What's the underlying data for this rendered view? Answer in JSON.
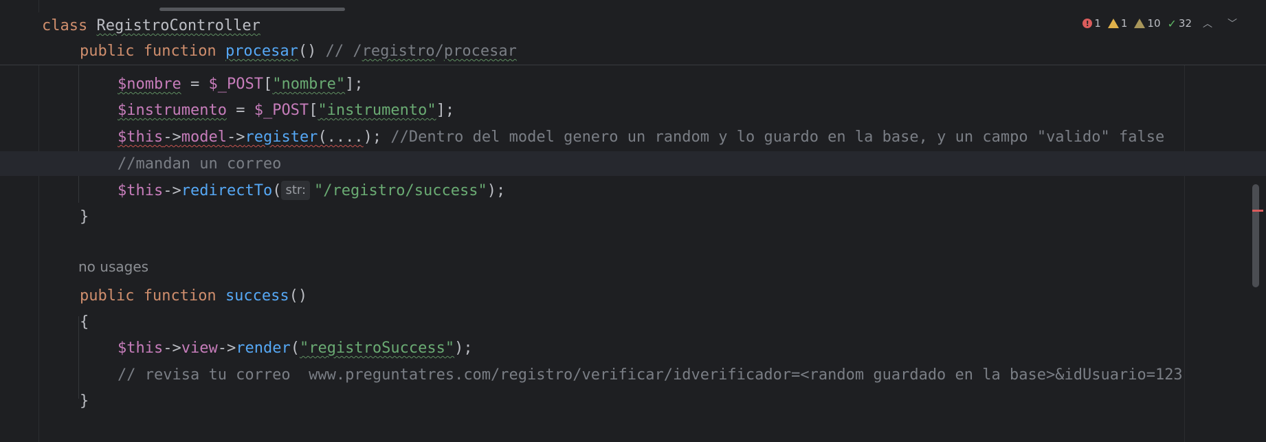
{
  "colors": {
    "background": "#1e1f22",
    "keyword": "#cf8e6d",
    "variable": "#c77dbb",
    "function": "#56a8f5",
    "string": "#6aab73",
    "comment": "#7a7e85",
    "text": "#bcbec4"
  },
  "inspections": {
    "errors": "1",
    "warnings": "1",
    "weak_warnings": "10",
    "typos": "32",
    "up_icon": "chevron-up-icon",
    "down_icon": "chevron-down-icon"
  },
  "sticky": {
    "class_kw": "class ",
    "class_name": "RegistroController",
    "fn_public": "public ",
    "fn_function": "function ",
    "fn_name": "procesar",
    "fn_parens": "() ",
    "fn_comment_pre": "// /",
    "fn_comment_w1": "registro",
    "fn_comment_sep": "/",
    "fn_comment_w2": "procesar"
  },
  "code": {
    "l1_var": "$nombre",
    "l1_op": " = ",
    "l1_post": "$_POST",
    "l1_br_open": "[",
    "l1_str": "\"nombre\"",
    "l1_br_close": "];",
    "l2_var": "$instrumento",
    "l2_op": " = ",
    "l2_post": "$_POST",
    "l2_br_open": "[",
    "l2_str": "\"instrumento\"",
    "l2_br_close": "];",
    "l3_this": "$this",
    "l3_arrow1": "->",
    "l3_model": "model",
    "l3_arrow2": "->",
    "l3_register": "register",
    "l3_args": "(....",
    "l3_close": ");",
    "l3_comment": " //Dentro del model genero un random y lo guardo en la base, y un campo \"valido\" false",
    "l4_comment": "//mandan un correo",
    "l5_this": "$this",
    "l5_arrow": "->",
    "l5_fn": "redirectTo",
    "l5_open": "(",
    "l5_hint": "str:",
    "l5_str": "\"/registro/success\"",
    "l5_close": ");",
    "l6_brace": "}",
    "usages": "no usages",
    "l7_public": "public ",
    "l7_function": "function ",
    "l7_name": "success",
    "l7_parens": "()",
    "l8_brace": "{",
    "l9_this": "$this",
    "l9_arrow1": "->",
    "l9_view": "view",
    "l9_arrow2": "->",
    "l9_render": "render",
    "l9_open": "(",
    "l9_str": "\"registroSuccess\"",
    "l9_close": ");",
    "l10_comment": "// revisa tu correo  www.preguntatres.com/registro/verificar/idverificador=<random guardado en la base>&idUsuario=123",
    "l11_brace": "}"
  }
}
